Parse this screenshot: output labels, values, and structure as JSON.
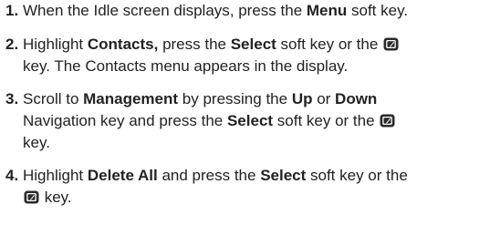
{
  "steps": [
    {
      "number": "1.",
      "lines": [
        [
          {
            "t": "When the Idle screen displays, press the "
          },
          {
            "t": "Menu",
            "b": true
          },
          {
            "t": " soft key."
          }
        ]
      ]
    },
    {
      "number": "2.",
      "lines": [
        [
          {
            "t": "Highlight "
          },
          {
            "t": "Contacts,",
            "b": true
          },
          {
            "t": " press the "
          },
          {
            "t": "Select",
            "b": true
          },
          {
            "t": " soft key or the "
          },
          {
            "icon": "ok-key-icon"
          }
        ],
        [
          {
            "t": "key. The Contacts menu appears in the display."
          }
        ]
      ]
    },
    {
      "number": "3.",
      "lines": [
        [
          {
            "t": "Scroll to "
          },
          {
            "t": "Management",
            "b": true
          },
          {
            "t": " by pressing the "
          },
          {
            "t": "Up",
            "b": true
          },
          {
            "t": " or "
          },
          {
            "t": "Down",
            "b": true
          }
        ],
        [
          {
            "t": "Navigation key and press the "
          },
          {
            "t": "Select",
            "b": true
          },
          {
            "t": " soft key or the "
          },
          {
            "icon": "ok-key-icon"
          }
        ],
        [
          {
            "t": "key."
          }
        ]
      ]
    },
    {
      "number": "4.",
      "lines": [
        [
          {
            "t": "Highlight "
          },
          {
            "t": "Delete All",
            "b": true
          },
          {
            "t": " and press the "
          },
          {
            "t": "Select",
            "b": true
          },
          {
            "t": " soft key or the"
          }
        ],
        [
          {
            "icon": "ok-key-icon"
          },
          {
            "t": " key."
          }
        ]
      ]
    }
  ]
}
